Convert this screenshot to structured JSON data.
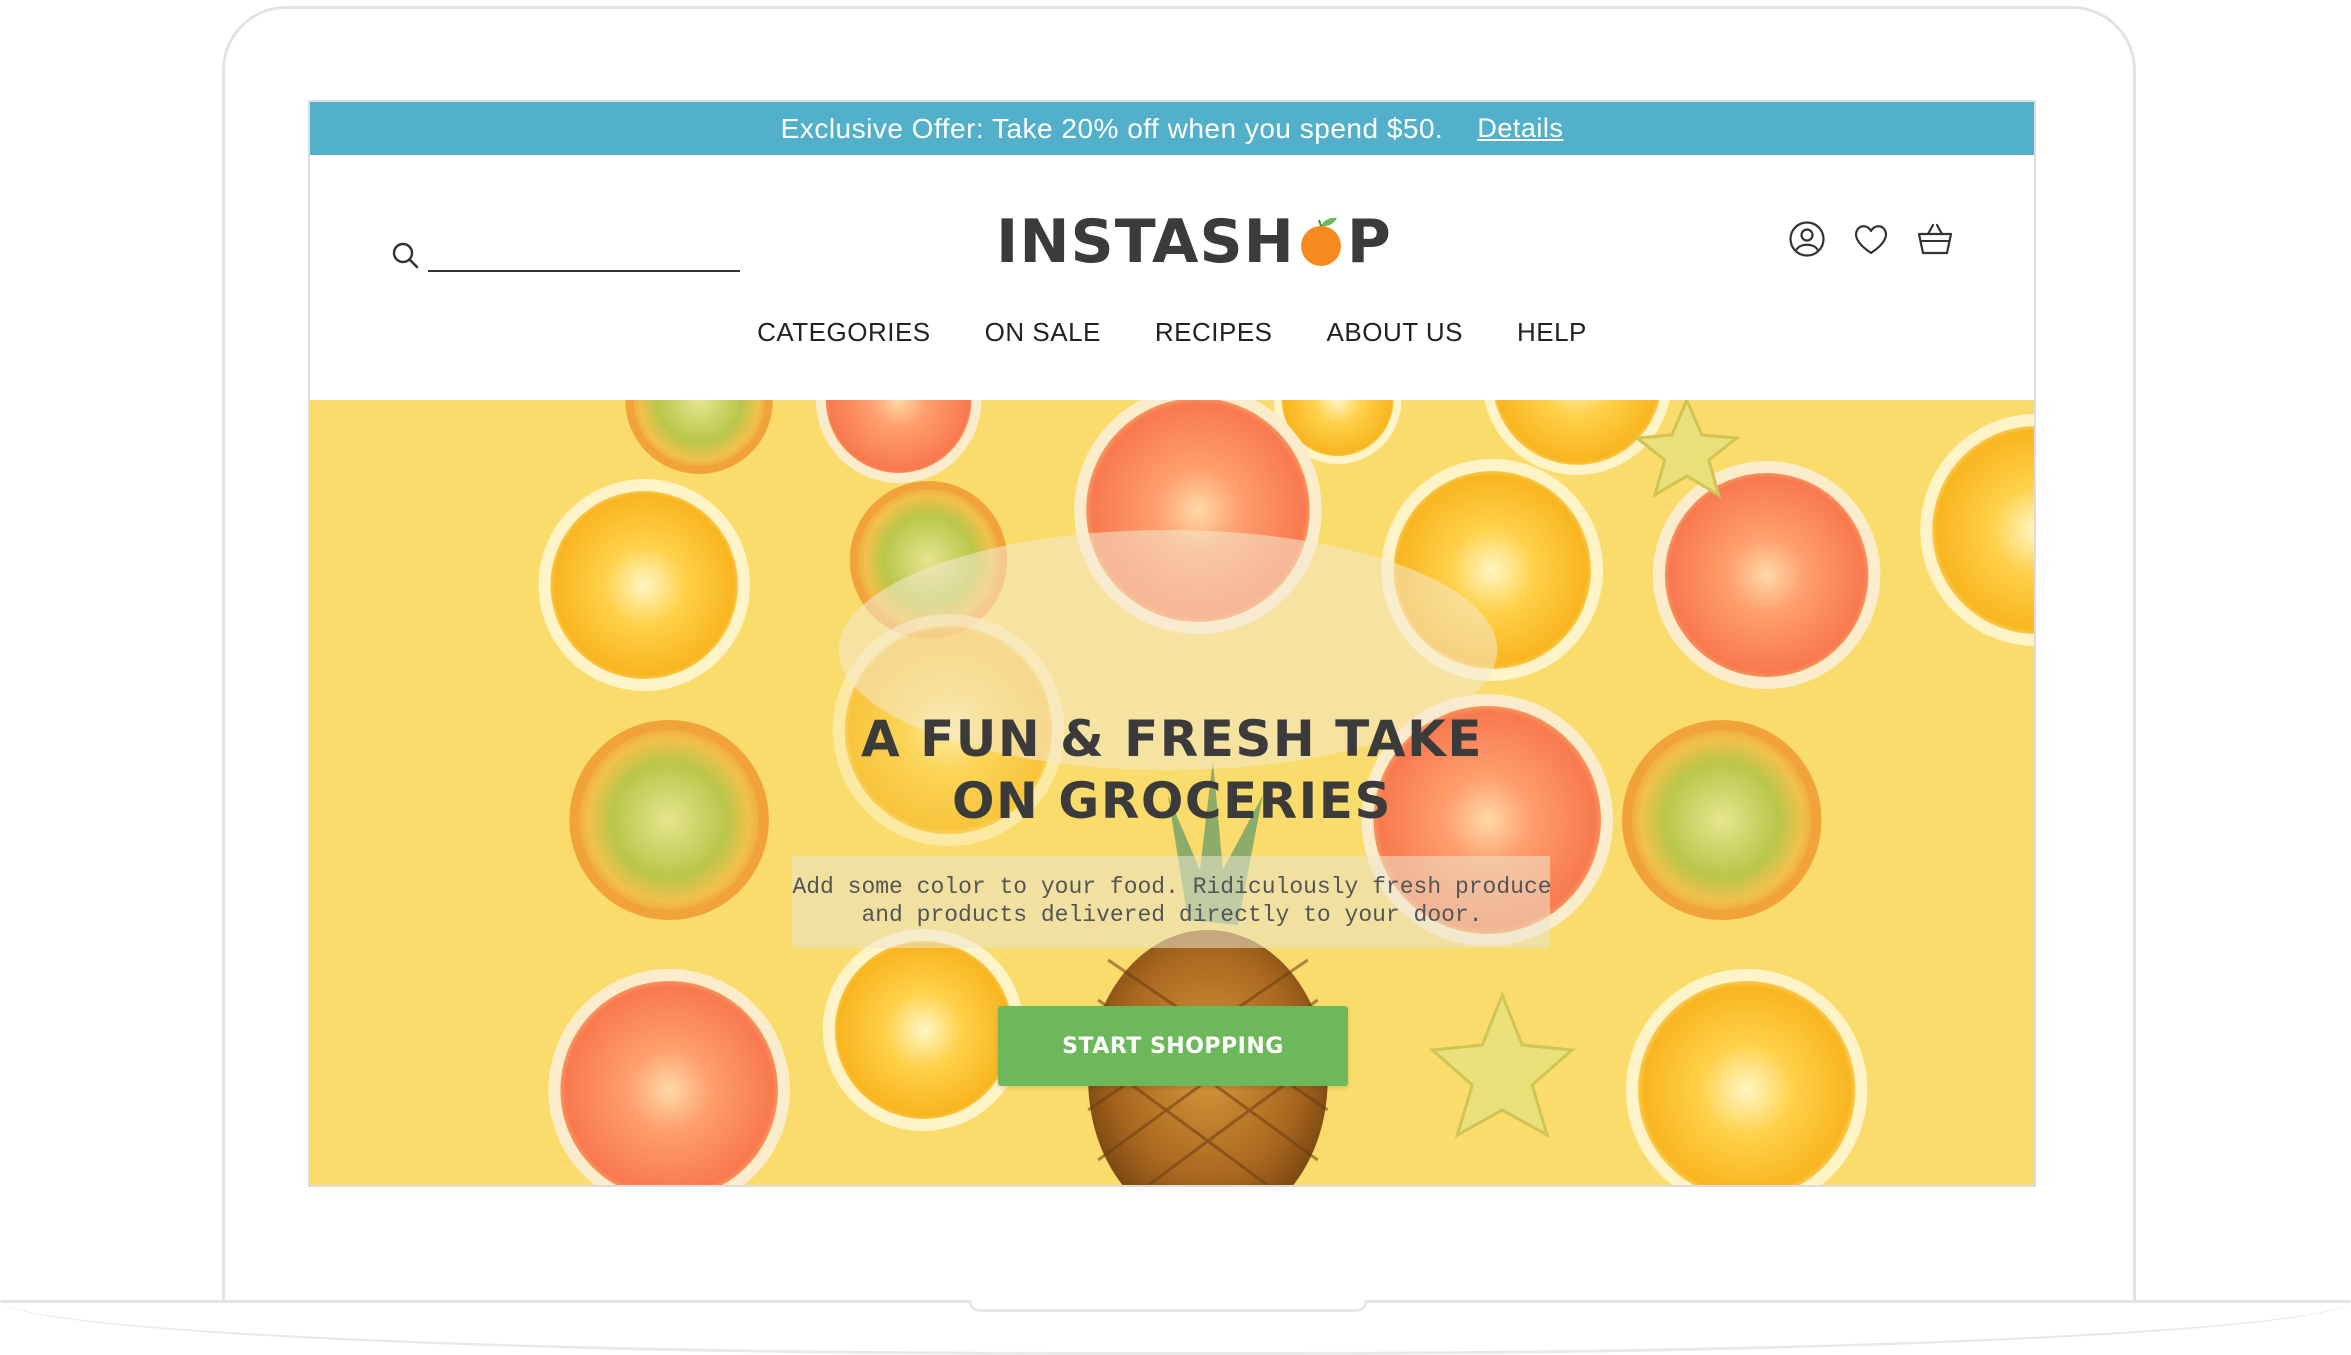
{
  "promo": {
    "text": "Exclusive Offer: Take 20% off when you spend $50.",
    "link_label": "Details"
  },
  "header": {
    "logo_prefix": "INSTASH",
    "logo_suffix": "P",
    "search_placeholder": "",
    "icons": [
      "user-icon",
      "heart-icon",
      "basket-icon"
    ]
  },
  "nav": {
    "items": [
      "CATEGORIES",
      "ON SALE",
      "RECIPES",
      "ABOUT US",
      "HELP"
    ]
  },
  "hero": {
    "title_line1": "A FUN & FRESH TAKE",
    "title_line2": "ON GROCERIES",
    "subtitle_line1": "Add some color to your food. Ridiculously fresh produce",
    "subtitle_line2": "and products delivered directly to your door.",
    "cta_label": "START SHOPPING"
  },
  "colors": {
    "promo_bar": "#53b0cb",
    "cta": "#6cb85a",
    "hero_background": "#f9dc6b",
    "logo_text": "#3b3b3b",
    "logo_orange": "#f58a1f"
  }
}
